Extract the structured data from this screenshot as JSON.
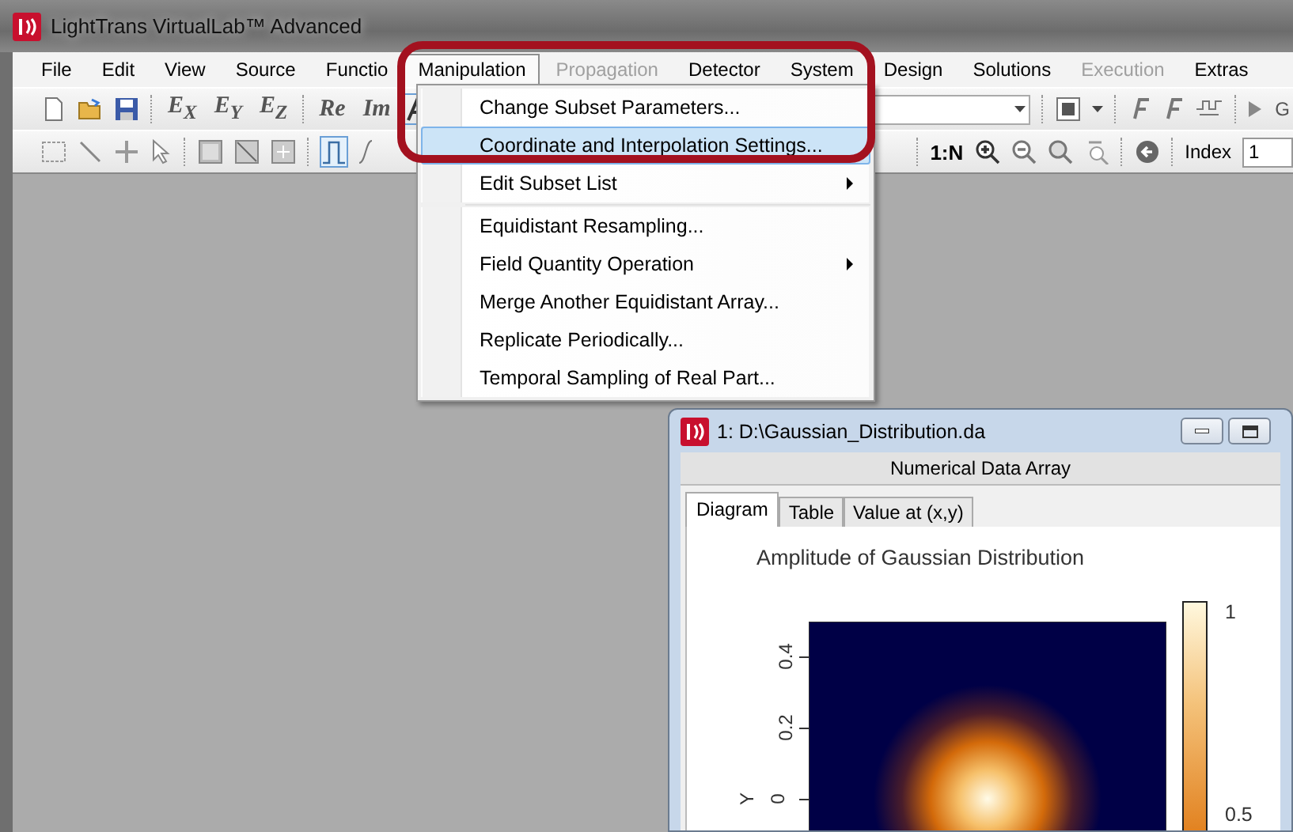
{
  "window": {
    "title": "LightTrans VirtualLab™ Advanced"
  },
  "menu_bar": [
    {
      "label": "File",
      "selected": false,
      "disabled": false
    },
    {
      "label": "Edit",
      "selected": false,
      "disabled": false
    },
    {
      "label": "View",
      "selected": false,
      "disabled": false
    },
    {
      "label": "Source",
      "selected": false,
      "disabled": false
    },
    {
      "label": "Functio",
      "selected": false,
      "disabled": false
    },
    {
      "label": "Manipulation",
      "selected": true,
      "disabled": false
    },
    {
      "label": "Propagation",
      "selected": false,
      "disabled": true
    },
    {
      "label": "Detector",
      "selected": false,
      "disabled": false
    },
    {
      "label": "System",
      "selected": false,
      "disabled": false
    },
    {
      "label": "Design",
      "selected": false,
      "disabled": false
    },
    {
      "label": "Solutions",
      "selected": false,
      "disabled": false
    },
    {
      "label": "Execution",
      "selected": false,
      "disabled": true
    },
    {
      "label": "Extras",
      "selected": false,
      "disabled": false
    }
  ],
  "toolbar_1": {
    "field_buttons": [
      "E$_{X}$",
      "E$_{Y}$",
      "E$_{Z}$"
    ],
    "part_buttons": [
      "Re",
      "Im"
    ],
    "cut_button": "G"
  },
  "toolbar_2": {
    "ratio_button": "1:N",
    "index_label": "Index",
    "index_value": "1"
  },
  "manipulation_menu": [
    {
      "kind": "item",
      "label": "Change Subset Parameters...",
      "selected": false,
      "submenu": false
    },
    {
      "kind": "item",
      "label": "Coordinate and Interpolation Settings...",
      "selected": true,
      "submenu": false
    },
    {
      "kind": "item",
      "label": "Edit Subset List",
      "selected": false,
      "submenu": true
    },
    {
      "kind": "separator"
    },
    {
      "kind": "item",
      "label": "Equidistant Resampling...",
      "selected": false,
      "submenu": false
    },
    {
      "kind": "item",
      "label": "Field Quantity Operation",
      "selected": false,
      "submenu": true
    },
    {
      "kind": "item",
      "label": "Merge Another Equidistant Array...",
      "selected": false,
      "submenu": false
    },
    {
      "kind": "item",
      "label": "Replicate Periodically...",
      "selected": false,
      "submenu": false
    },
    {
      "kind": "item",
      "label": "Temporal Sampling of Real Part...",
      "selected": false,
      "submenu": false
    }
  ],
  "child_window": {
    "title": "1: D:\\Gaussian_Distribution.da",
    "subtitle": "Numerical Data Array",
    "tabs": [
      {
        "label": "Diagram",
        "selected": true
      },
      {
        "label": "Table",
        "selected": false
      },
      {
        "label": "Value at (x,y)",
        "selected": false
      }
    ],
    "plot": {
      "title": "Amplitude of Gaussian Distribution",
      "y_label": "Y",
      "y_ticks": [
        "0.4",
        "0.2",
        "0"
      ],
      "colorbar_ticks": [
        "1",
        "0.5"
      ]
    }
  }
}
